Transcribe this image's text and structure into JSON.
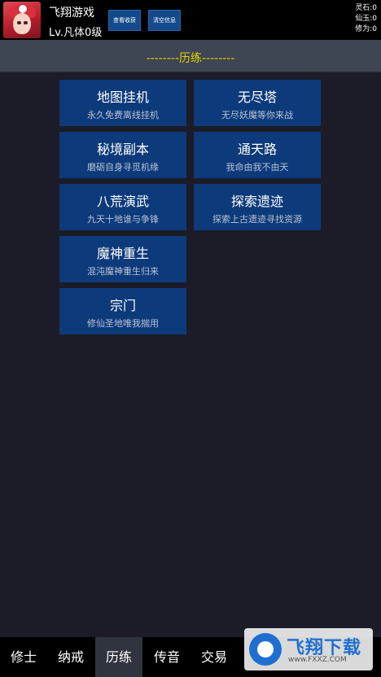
{
  "header": {
    "player_name": "飞翔游戏",
    "player_level": "Lv.凡体0级",
    "btn_view_harvest": "查看收获",
    "btn_clear_info": "清空信息",
    "resources": [
      "灵石:0",
      "仙玉:0",
      "修为:0"
    ]
  },
  "section": {
    "title": "--------历练--------"
  },
  "tiles": [
    {
      "title": "地图挂机",
      "subtitle": "永久免费离线挂机"
    },
    {
      "title": "无尽塔",
      "subtitle": "无尽妖魔等你来战"
    },
    {
      "title": "秘境副本",
      "subtitle": "磨砺自身寻觅机缘"
    },
    {
      "title": "通天路",
      "subtitle": "我命由我不由天"
    },
    {
      "title": "八荒演武",
      "subtitle": "九天十地谁与争锋"
    },
    {
      "title": "探索遗迹",
      "subtitle": "探索上古遗迹寻找资源"
    },
    {
      "title": "魔神重生",
      "subtitle": "混沌魔神重生归来"
    },
    {
      "title": "宗门",
      "subtitle": "修仙圣地唯我揣用"
    }
  ],
  "nav": [
    "修士",
    "纳戒",
    "历练",
    "传音",
    "交易"
  ],
  "nav_active": "历练",
  "watermark": {
    "text": "飞翔下载",
    "url": "www.FXXZ.COM"
  }
}
